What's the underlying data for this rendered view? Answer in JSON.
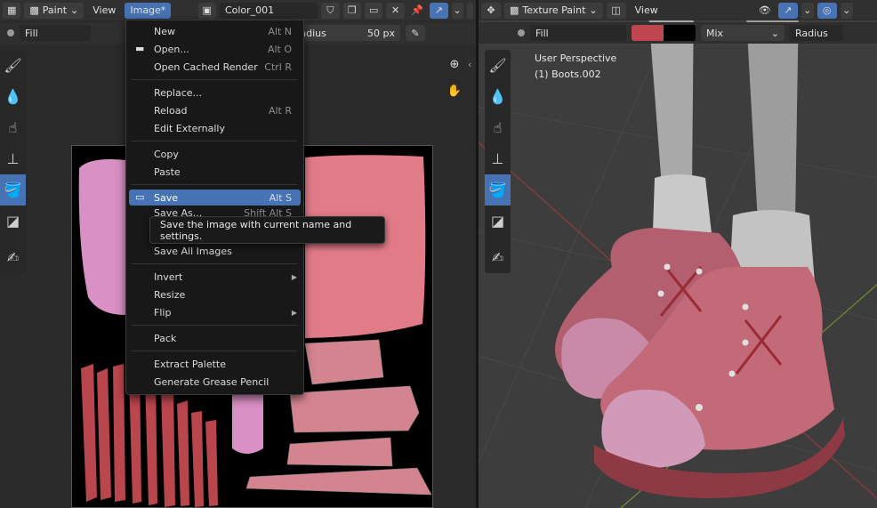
{
  "left_header": {
    "mode": "Paint",
    "menu_view": "View",
    "menu_image": "Image*",
    "image_name": "Color_001"
  },
  "left_toolbar": {
    "brush": "Fill",
    "radius_label": "Radius",
    "radius_value": "50 px"
  },
  "image_menu": {
    "items": [
      {
        "label": "New",
        "shortcut": "Alt N"
      },
      {
        "label": "Open...",
        "shortcut": "Alt O"
      },
      {
        "label": "Open Cached Render",
        "shortcut": "Ctrl R"
      },
      {
        "label": "Replace...",
        "shortcut": ""
      },
      {
        "label": "Reload",
        "shortcut": "Alt R"
      },
      {
        "label": "Edit Externally",
        "shortcut": ""
      },
      {
        "label": "Copy",
        "shortcut": ""
      },
      {
        "label": "Paste",
        "shortcut": ""
      },
      {
        "label": "Save",
        "shortcut": "Alt S"
      },
      {
        "label": "Save As...",
        "shortcut": "Shift Alt S"
      },
      {
        "label": "Save All Images",
        "shortcut": ""
      },
      {
        "label": "Invert",
        "shortcut": ""
      },
      {
        "label": "Resize",
        "shortcut": ""
      },
      {
        "label": "Flip",
        "shortcut": ""
      },
      {
        "label": "Pack",
        "shortcut": ""
      },
      {
        "label": "Extract Palette",
        "shortcut": ""
      },
      {
        "label": "Generate Grease Pencil",
        "shortcut": ""
      }
    ],
    "tooltip": "Save the image with current name and settings."
  },
  "right_header": {
    "mode": "Texture Paint",
    "menu_view": "View"
  },
  "right_toolbar": {
    "brush": "Fill",
    "blend": "Mix",
    "radius_label": "Radius",
    "color": "#c0474f"
  },
  "viewport": {
    "perspective": "User Perspective",
    "object": "(1) Boots.002"
  },
  "colors": {
    "accent": "#4772b3",
    "header": "#303030",
    "menu_bg": "#181818"
  }
}
